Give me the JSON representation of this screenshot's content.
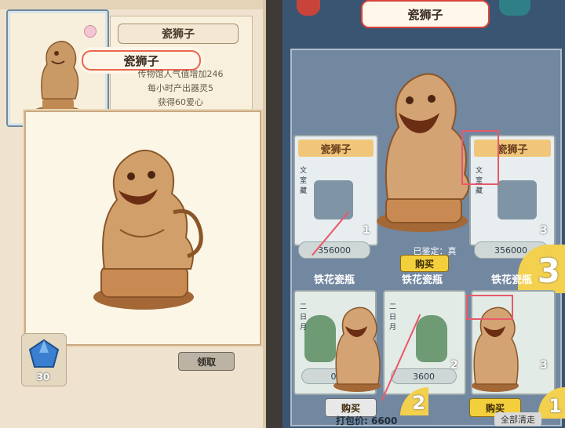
{
  "left_panel": {
    "item_title": "瓷狮子",
    "ribbon_label": "瓷狮子",
    "info_lines": [
      "传物馆人气值增加246",
      "每小时产出器灵5",
      "获得60爱心"
    ],
    "claim_label": "领取",
    "crystal_count": "30"
  },
  "right_panel": {
    "header_title": "瓷狮子",
    "top_slots": [
      {
        "title": "瓷狮子",
        "price": "356000",
        "tag": "文室藏"
      },
      {
        "title": "瓷狮子",
        "price": "",
        "tag": ""
      },
      {
        "title": "瓷狮子",
        "price": "356000",
        "tag": "文室藏"
      }
    ],
    "appraised_text": "已鉴定：真",
    "top_buy_label": "购买",
    "row_labels": [
      "铁花瓷瓶",
      "铁花瓷瓶",
      "铁花瓷瓶"
    ],
    "bottom_slots": [
      {
        "price": "0",
        "tag": "二日月"
      },
      {
        "price": "3600",
        "tag": "二日月"
      },
      {
        "price": "",
        "tag": ""
      }
    ],
    "bottom_buy_labels": [
      "购买",
      "购买"
    ],
    "corner_numbers": [
      "3",
      "2",
      "1"
    ],
    "slot_numbers": [
      "1",
      "2",
      "3",
      "2",
      "3"
    ],
    "footer_text": "打包价: 6600",
    "footer_right": "全部清走"
  },
  "colors": {
    "accent_red": "#e8596a",
    "button_yellow": "#f3cf3c",
    "paper": "#efe3cf",
    "blue_bg": "#395572"
  }
}
